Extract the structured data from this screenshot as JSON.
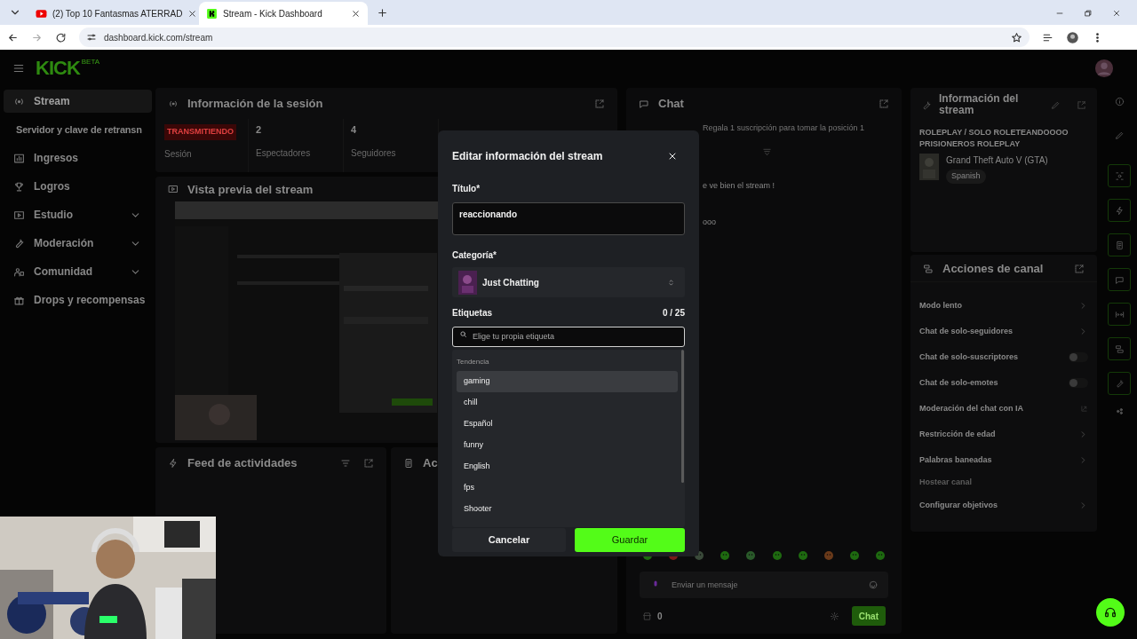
{
  "browser": {
    "tabs": [
      {
        "title": "(2) Top 10 Fantasmas ATERRAD",
        "kind": "video",
        "selected": false
      },
      {
        "title": "Stream - Kick Dashboard",
        "kind": "dashboard",
        "selected": true
      }
    ],
    "url": "dashboard.kick.com/stream"
  },
  "header": {
    "logo": "KICK",
    "logo_badge": "BETA"
  },
  "sidebar": {
    "items": [
      {
        "label": "Stream",
        "selected": true,
        "expandable": false,
        "children": [
          {
            "label": "Servidor y clave de retransn",
            "selected": false
          }
        ]
      },
      {
        "label": "Ingresos",
        "selected": false,
        "expandable": false
      },
      {
        "label": "Logros",
        "selected": false,
        "expandable": false
      },
      {
        "label": "Estudio",
        "selected": false,
        "expandable": true
      },
      {
        "label": "Moderación",
        "selected": false,
        "expandable": true
      },
      {
        "label": "Comunidad",
        "selected": false,
        "expandable": true
      },
      {
        "label": "Drops y recompensas",
        "selected": false,
        "expandable": false
      }
    ]
  },
  "session": {
    "title": "Información de la sesión",
    "status": "TRANSMITIENDO",
    "status_label": "Sesión",
    "stats": [
      {
        "value": "2",
        "label": "Espectadores"
      },
      {
        "value": "4",
        "label": "Seguidores"
      }
    ]
  },
  "preview": {
    "title": "Vista previa del stream"
  },
  "feed": {
    "title": "Feed de actividades"
  },
  "cut_panel": {
    "title": "Ac"
  },
  "chat": {
    "title": "Chat",
    "pinned": "Regala 1 suscripción para tomar la posición 1",
    "messages": [
      "e ve bien el stream !",
      "ooo"
    ],
    "input_placeholder": "Enviar un mensaje",
    "count": "0",
    "send": "Chat"
  },
  "stream_info": {
    "title": "Información del stream",
    "stream_title": "ROLEPLAY / SOLO ROLETEANDOOOO PRISIONEROS ROLEPLAY",
    "category": "Grand Theft Auto V (GTA)",
    "tags": [
      "Spanish"
    ]
  },
  "channel_actions": {
    "title": "Acciones de canal",
    "items": [
      {
        "label": "Modo lento",
        "kind": "chevron",
        "disabled": false
      },
      {
        "label": "Chat de solo-seguidores",
        "kind": "chevron",
        "disabled": false
      },
      {
        "label": "Chat de solo-suscriptores",
        "kind": "toggle",
        "on": false,
        "disabled": false
      },
      {
        "label": "Chat de solo-emotes",
        "kind": "toggle",
        "on": false,
        "disabled": false
      },
      {
        "label": "Moderación del chat con IA",
        "kind": "external",
        "disabled": false
      },
      {
        "label": "Restricción de edad",
        "kind": "chevron",
        "disabled": false
      },
      {
        "label": "Palabras baneadas",
        "kind": "chevron",
        "disabled": false
      },
      {
        "label": "Hostear canal",
        "kind": "plain",
        "disabled": true
      },
      {
        "label": "Configurar objetivos",
        "kind": "chevron",
        "disabled": false
      }
    ]
  },
  "modal": {
    "title": "Editar información del stream",
    "title_label": "Título*",
    "title_value": "reaccionando",
    "category_label": "Categoría*",
    "category_value": "Just Chatting",
    "tags_label": "Etiquetas",
    "tags_count": "0 / 25",
    "tags_placeholder": "Elige tu propia etiqueta",
    "suggestions_heading": "Tendencia",
    "suggestions": [
      {
        "label": "gaming",
        "selected": true
      },
      {
        "label": "chill",
        "selected": false
      },
      {
        "label": "Español",
        "selected": false
      },
      {
        "label": "funny",
        "selected": false
      },
      {
        "label": "English",
        "selected": false
      },
      {
        "label": "fps",
        "selected": false
      },
      {
        "label": "Shooter",
        "selected": false
      }
    ],
    "cancel": "Cancelar",
    "save": "Guardar"
  }
}
